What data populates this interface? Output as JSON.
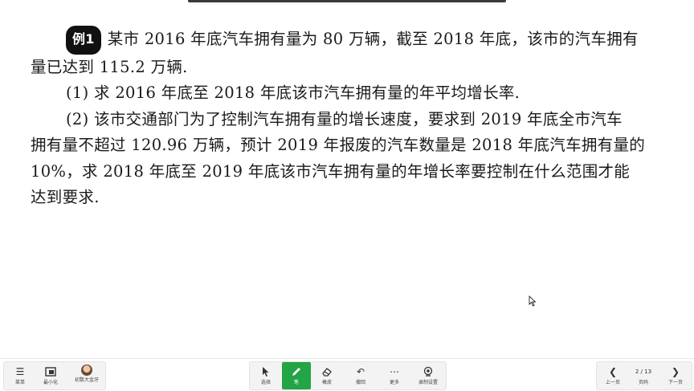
{
  "problem": {
    "badge": "例1",
    "intro_line1": "某市 2016 年底汽车拥有量为 80 万辆，截至 2018 年底，该市的汽车拥有",
    "intro_line2": "量已达到 115.2 万辆.",
    "q1": "(1) 求 2016 年底至 2018 年底该市汽车拥有量的年平均增长率.",
    "q2_line1": "(2) 该市交通部门为了控制汽车拥有量的增长速度，要求到 2019 年底全市汽车",
    "q2_line2": "拥有量不超过 120.96 万辆，预计 2019 年报废的汽车数量是 2018 年底汽车拥有量的",
    "q2_line3": "10%，求 2018 年底至 2019 年底该市汽车拥有量的年增长率要控制在什么范围才能",
    "q2_line4": "达到要求."
  },
  "toolbar": {
    "left": [
      {
        "label": "菜单",
        "icon": "menu-icon"
      },
      {
        "label": "最小化",
        "icon": "minimize-icon"
      },
      {
        "label": "初数大金牙",
        "icon": "avatar"
      }
    ],
    "center": [
      {
        "label": "选择",
        "icon": "pointer-icon"
      },
      {
        "label": "笔",
        "icon": "pen-icon"
      },
      {
        "label": "橡皮",
        "icon": "eraser-icon"
      },
      {
        "label": "撤回",
        "icon": "undo-icon"
      },
      {
        "label": "更多",
        "icon": "more-icon"
      },
      {
        "label": "录制设置",
        "icon": "record-icon"
      }
    ],
    "right": {
      "prev_label": "上一页",
      "page_indicator": "2 / 13",
      "page_label": "页码",
      "next_label": "下一页"
    },
    "accent": "#22a447"
  }
}
